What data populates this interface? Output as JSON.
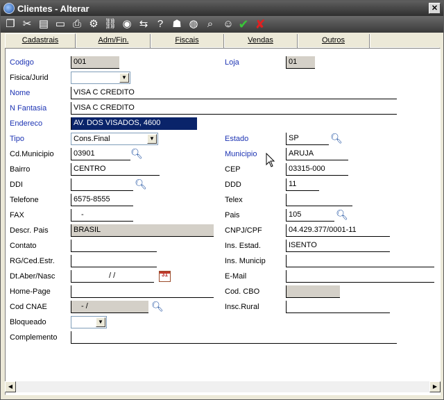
{
  "window": {
    "title": "Clientes - Alterar",
    "close_label": "✕"
  },
  "toolbar": {
    "icons": [
      "copy-icon",
      "cut-icon",
      "paste-icon",
      "money-icon",
      "print-icon",
      "settings-icon",
      "link-icon",
      "globe-icon",
      "transfer-icon",
      "help-icon",
      "user-icon",
      "globe2-icon",
      "search-doc-icon",
      "person-icon",
      "confirm-check-icon",
      "cancel-x-icon"
    ]
  },
  "tabs": [
    {
      "label": "Cadastrais"
    },
    {
      "label": "Adm/Fin."
    },
    {
      "label": "Fiscais"
    },
    {
      "label": "Vendas"
    },
    {
      "label": "Outros"
    }
  ],
  "form": {
    "codigo": {
      "label": "Codigo",
      "value": "001"
    },
    "loja": {
      "label": "Loja",
      "value": "01"
    },
    "fisica_jurid": {
      "label": "Fisica/Jurid",
      "value": ""
    },
    "nome": {
      "label": "Nome",
      "value": "VISA C CREDITO"
    },
    "n_fantasia": {
      "label": "N Fantasia",
      "value": "VISA C CREDITO"
    },
    "endereco": {
      "label": "Endereco",
      "value": "AV. DOS VISADOS, 4600"
    },
    "tipo": {
      "label": "Tipo",
      "value": "Cons.Final"
    },
    "estado": {
      "label": "Estado",
      "value": "SP"
    },
    "cd_municipio": {
      "label": "Cd.Municipio",
      "value": "03901"
    },
    "municipio": {
      "label": "Municipio",
      "value": "ARUJA"
    },
    "bairro": {
      "label": "Bairro",
      "value": "CENTRO"
    },
    "cep": {
      "label": "CEP",
      "value": "03315-000"
    },
    "ddi": {
      "label": "DDI",
      "value": ""
    },
    "ddd": {
      "label": "DDD",
      "value": "11"
    },
    "telefone": {
      "label": "Telefone",
      "value": "6575-8555"
    },
    "telex": {
      "label": "Telex",
      "value": ""
    },
    "fax": {
      "label": "FAX",
      "value": "-"
    },
    "pais": {
      "label": "Pais",
      "value": "105"
    },
    "descr_pais": {
      "label": "Descr. Pais",
      "value": "BRASIL"
    },
    "cnpj_cpf": {
      "label": "CNPJ/CPF",
      "value": "04.429.377/0001-11"
    },
    "contato": {
      "label": "Contato",
      "value": ""
    },
    "ins_estad": {
      "label": "Ins. Estad.",
      "value": "ISENTO"
    },
    "rg": {
      "label": "RG/Ced.Estr.",
      "value": ""
    },
    "ins_municip": {
      "label": "Ins. Municip",
      "value": ""
    },
    "dt_aber": {
      "label": "Dt.Aber/Nasc",
      "value": "/ /"
    },
    "email": {
      "label": "E-Mail",
      "value": ""
    },
    "home_page": {
      "label": "Home-Page",
      "value": ""
    },
    "cod_cbo": {
      "label": "Cod. CBO",
      "value": ""
    },
    "cod_cnae": {
      "label": "Cod CNAE",
      "value": "- /"
    },
    "insc_rural": {
      "label": "Insc.Rural",
      "value": ""
    },
    "bloqueado": {
      "label": "Bloqueado",
      "value": ""
    },
    "complemento": {
      "label": "Complemento",
      "value": ""
    }
  },
  "scrollbar": {
    "left_arrow": "◀",
    "right_arrow": "▶"
  },
  "colors": {
    "required_label": "#1c33b3",
    "selection": "#0a246a",
    "readonly": "#d4d0c8"
  }
}
